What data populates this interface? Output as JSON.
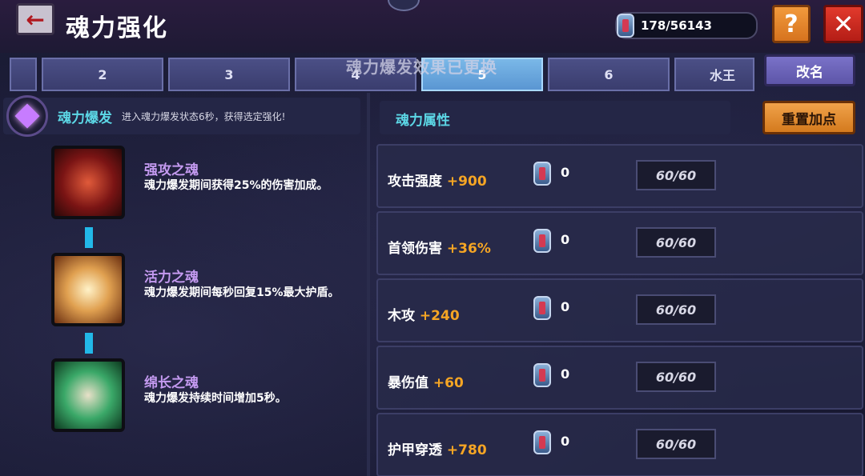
{
  "header": {
    "back_icon": "left-arrow-icon",
    "title": "魂力强化",
    "currency": {
      "icon": "soul-gem-icon",
      "value": "178/56143"
    },
    "help_label": "?",
    "close_label": "✕"
  },
  "tabs": {
    "items": [
      {
        "label": ""
      },
      {
        "label": "2"
      },
      {
        "label": "3"
      },
      {
        "label": "4"
      },
      {
        "label": "5"
      },
      {
        "label": "6"
      },
      {
        "label": "水王"
      }
    ],
    "active_index": 4,
    "toast": "魂力爆发效果已更换",
    "rename_label": "改名"
  },
  "burst": {
    "name": "魂力爆发",
    "desc": "进入魂力爆发状态6秒，获得选定强化!"
  },
  "souls": [
    {
      "name": "强攻之魂",
      "desc": "魂力爆发期间获得25%的伤害加成。"
    },
    {
      "name": "活力之魂",
      "desc": "魂力爆发期间每秒回复15%最大护盾。"
    },
    {
      "name": "绵长之魂",
      "desc": "魂力爆发持续时间增加5秒。"
    }
  ],
  "attributes": {
    "title": "魂力属性",
    "reset_label": "重置加点",
    "rows": [
      {
        "name": "攻击强度",
        "bonus": "+900",
        "cost": "0",
        "level": "60/60"
      },
      {
        "name": "首领伤害",
        "bonus": "+36%",
        "cost": "0",
        "level": "60/60"
      },
      {
        "name": "木攻",
        "bonus": "+240",
        "cost": "0",
        "level": "60/60"
      },
      {
        "name": "暴伤值",
        "bonus": "+60",
        "cost": "0",
        "level": "60/60"
      },
      {
        "name": "护甲穿透",
        "bonus": "+780",
        "cost": "0",
        "level": "60/60"
      }
    ]
  },
  "colors": {
    "accent_cyan": "#5cd7e6",
    "bonus_orange": "#f5a524",
    "soul_name_purple": "#c49af0",
    "active_tab": "#7ab8e8"
  }
}
